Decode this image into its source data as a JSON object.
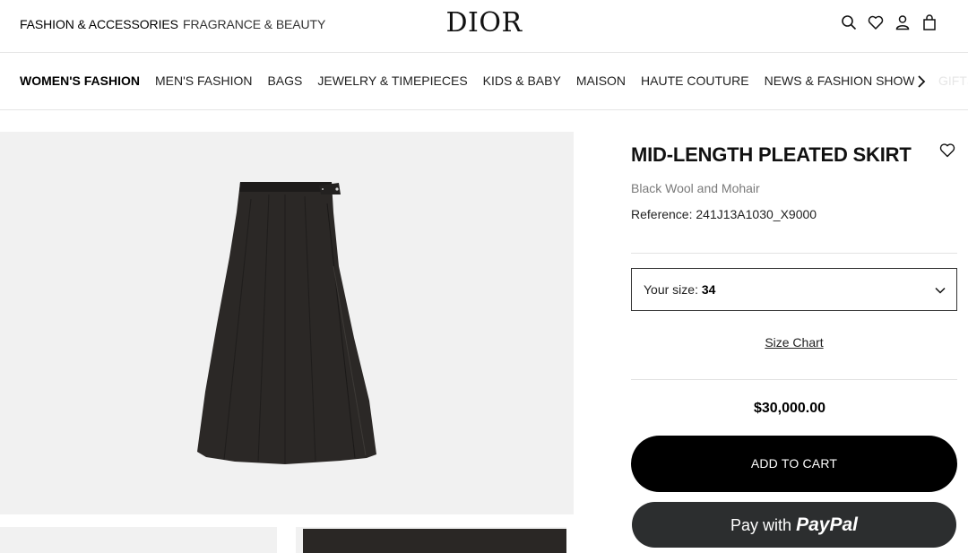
{
  "header": {
    "nav_primary": "FASHION & ACCESSORIES",
    "nav_secondary": "FRAGRANCE & BEAUTY",
    "logo": "DIOR",
    "icons": [
      "search-icon",
      "heart-icon",
      "user-icon",
      "bag-icon"
    ]
  },
  "categories": {
    "items": [
      {
        "label": "WOMEN'S FASHION"
      },
      {
        "label": "MEN'S FASHION"
      },
      {
        "label": "BAGS"
      },
      {
        "label": "JEWELRY & TIMEPIECES"
      },
      {
        "label": "KIDS & BABY"
      },
      {
        "label": "MAISON"
      },
      {
        "label": "HAUTE COUTURE"
      },
      {
        "label": "NEWS & FASHION SHOWS"
      },
      {
        "label": "GIFTS & "
      }
    ],
    "active": "WOMEN'S FASHION",
    "next_icon": "chevron-right-icon"
  },
  "product": {
    "title": "MID-LENGTH PLEATED SKIRT",
    "subtitle": "Black Wool and Mohair",
    "reference_label": "Reference:",
    "reference_value": "241J13A1030_X9000",
    "size_label": "Your size:",
    "size_value": "34",
    "size_chart": "Size Chart",
    "price": "$30,000.00",
    "add_to_cart": "ADD TO CART",
    "paypal_prefix": "Pay with",
    "paypal_brand": "PayPal"
  },
  "colors": {
    "accent": "#000000",
    "paypal_button": "#2c2e2f",
    "image_background": "#f1f1f1",
    "muted_text": "#7a7a7a"
  }
}
